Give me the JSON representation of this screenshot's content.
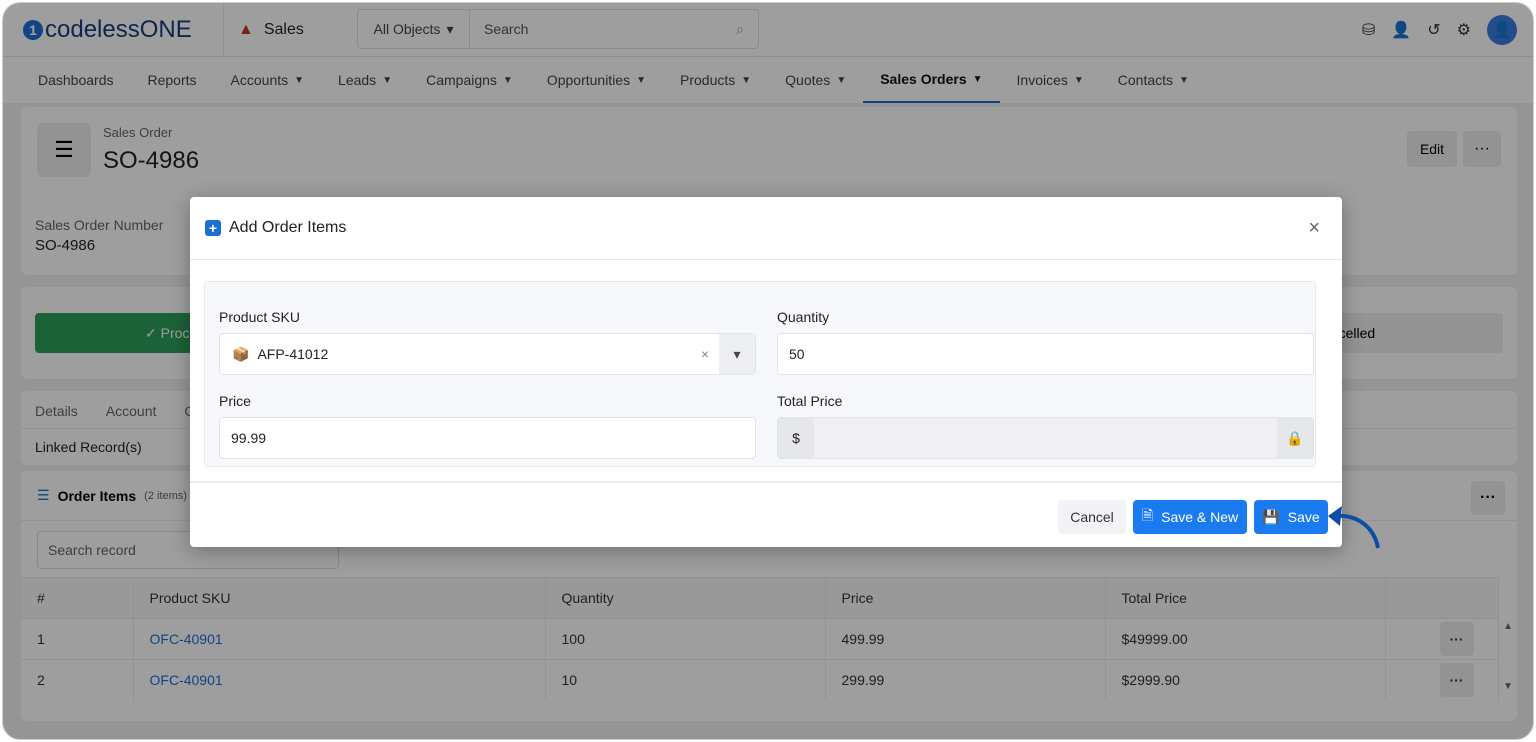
{
  "brand": {
    "logo": "codelessONE",
    "app": "Sales"
  },
  "search": {
    "scope": "All Objects",
    "placeholder": "Search"
  },
  "nav": [
    "Dashboards",
    "Reports",
    "Accounts",
    "Leads",
    "Campaigns",
    "Opportunities",
    "Products",
    "Quotes",
    "Sales Orders",
    "Invoices",
    "Contacts"
  ],
  "nav_dropdown": [
    false,
    false,
    true,
    true,
    true,
    true,
    true,
    true,
    true,
    true,
    true
  ],
  "nav_active": "Sales Orders",
  "record": {
    "type": "Sales Order",
    "title": "SO-4986",
    "edit": "Edit",
    "more": "···",
    "field_label": "Sales Order Number",
    "field_value": "SO-4986"
  },
  "stages": {
    "first": "Proc",
    "last": "ancelled"
  },
  "tabs": [
    "Details",
    "Account",
    "C"
  ],
  "linked": "Linked Record(s)",
  "order_items": {
    "title": "Order Items",
    "count": "(2 items)",
    "search_placeholder": "Search record",
    "more": "···",
    "columns": [
      "#",
      "Product SKU",
      "Quantity",
      "Price",
      "Total Price"
    ],
    "rows": [
      [
        "1",
        "OFC-40901",
        "100",
        "499.99",
        "$49999.00"
      ],
      [
        "2",
        "OFC-40901",
        "10",
        "299.99",
        "$2999.90"
      ]
    ]
  },
  "modal": {
    "title": "Add Order Items",
    "sku_label": "Product SKU",
    "sku_value": "AFP-41012",
    "qty_label": "Quantity",
    "qty_value": "50",
    "price_label": "Price",
    "price_value": "99.99",
    "total_label": "Total Price",
    "currency": "$",
    "total_value": "",
    "cancel": "Cancel",
    "save_new": "Save & New",
    "save": "Save"
  },
  "colors": {
    "primary": "#1a7bf0",
    "success": "#2e9e5b",
    "annotation_arrow": "#0a4ea8"
  }
}
